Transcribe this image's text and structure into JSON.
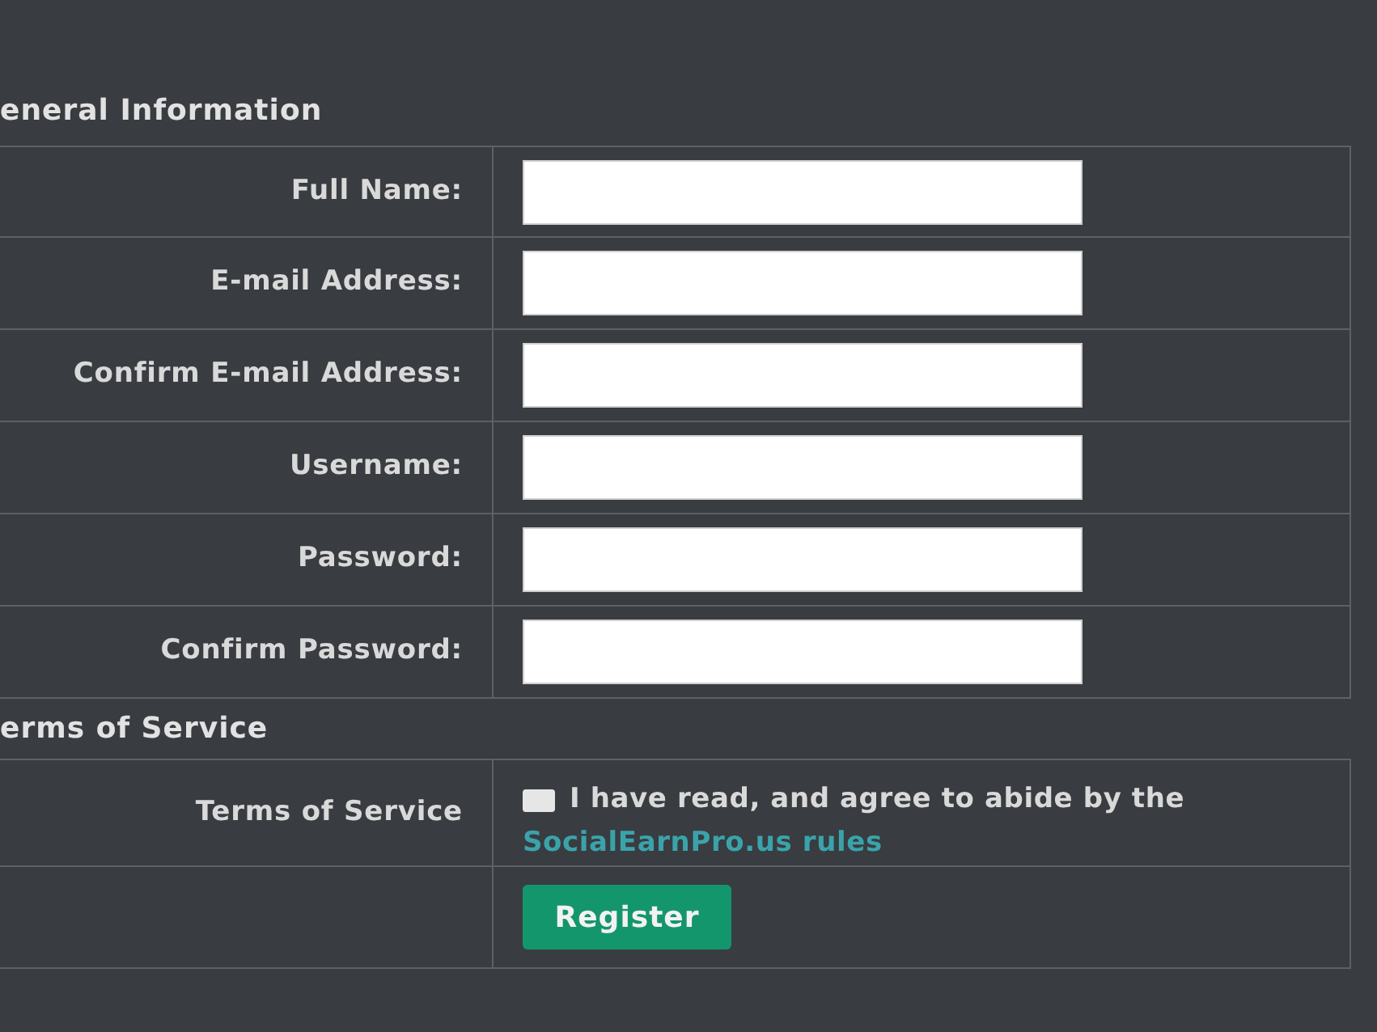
{
  "sections": [
    {
      "title": "eneral Information",
      "rows": [
        {
          "kind": "input",
          "label": "Full Name:"
        },
        {
          "kind": "input",
          "label": "E-mail Address:"
        },
        {
          "kind": "input",
          "label": "Confirm E-mail Address:"
        },
        {
          "kind": "input",
          "label": "Username:"
        },
        {
          "kind": "input",
          "label": "Password:"
        },
        {
          "kind": "input",
          "label": "Confirm Password:"
        }
      ]
    },
    {
      "title": "erms of Service",
      "rows": [
        {
          "kind": "checkbox",
          "label": "Terms of Service",
          "checked": false,
          "text": "I have read, and agree to abide by the",
          "link": "SocialEarnPro.us rules"
        },
        {
          "kind": "button",
          "button": "Register"
        }
      ]
    }
  ]
}
